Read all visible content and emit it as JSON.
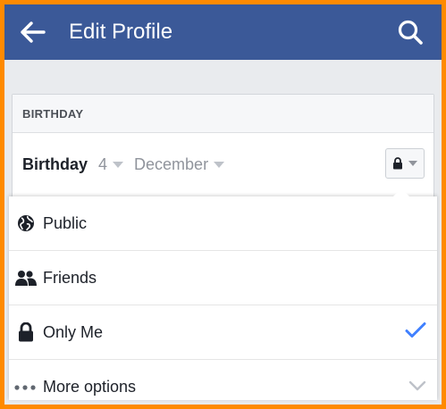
{
  "appbar": {
    "title": "Edit Profile",
    "back_icon": "arrow-left-icon",
    "search_icon": "search-icon",
    "color": "#3b5998"
  },
  "section": {
    "header": "BIRTHDAY",
    "label": "Birthday",
    "day": "4",
    "month": "December"
  },
  "privacy_menu": {
    "items": [
      {
        "label": "Public",
        "icon": "globe-icon",
        "selected": false
      },
      {
        "label": "Friends",
        "icon": "friends-icon",
        "selected": false
      },
      {
        "label": "Only Me",
        "icon": "lock-icon",
        "selected": true
      },
      {
        "label": "More options",
        "icon": "ellipsis-icon",
        "selected": false
      }
    ],
    "check_color": "#4080ff"
  },
  "frame_color": "#ff8a00"
}
